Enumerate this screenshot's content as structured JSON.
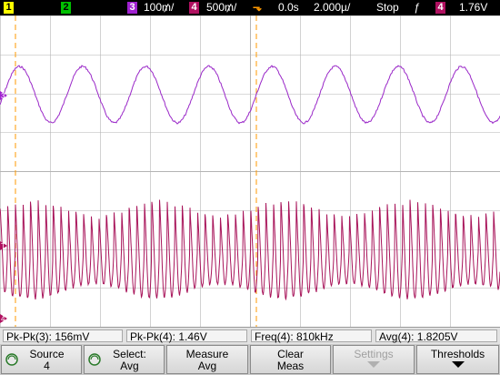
{
  "top_bar": {
    "ch1_label": "1",
    "ch2_label": "2",
    "ch3_label": "3",
    "ch3_scale": "100₥/",
    "ch4_label": "4",
    "ch4_scale": "500₥/",
    "trigger_marker": "⬎",
    "time_delay": "0.0s",
    "time_scale": "2.000µ/",
    "run_state": "Stop",
    "trigger_slope": "ƒ",
    "trigger_source": "4",
    "trigger_level": "1.76V"
  },
  "colors": {
    "ch1": "#ffff00",
    "ch2": "#00c000",
    "ch3": "#a020d0",
    "ch4": "#b01060",
    "grid": "#b4b4b4",
    "cursor": "#ff9900"
  },
  "screen": {
    "ch3_marker": "3",
    "trigger_level_marker": "T",
    "ch4_marker": "4"
  },
  "measurements": [
    {
      "label": "Pk-Pk(3): 156mV"
    },
    {
      "label": "Pk-Pk(4): 1.46V"
    },
    {
      "label": "Freq(4): 810kHz"
    },
    {
      "label": "Avg(4): 1.8205V"
    }
  ],
  "softkeys": [
    {
      "line1": "Source",
      "line2": "4",
      "icon": "knob-icon",
      "enabled": true
    },
    {
      "line1": "Select:",
      "line2": "Avg",
      "icon": "knob-icon",
      "enabled": true
    },
    {
      "line1": "Measure",
      "line2": "Avg",
      "icon": "",
      "enabled": true
    },
    {
      "line1": "Clear",
      "line2": "Meas",
      "icon": "",
      "enabled": true
    },
    {
      "line1": "Settings",
      "line2": "",
      "icon": "arrow-down-icon",
      "enabled": false
    },
    {
      "line1": "Thresholds",
      "line2": "",
      "icon": "arrow-down-icon",
      "enabled": true
    }
  ]
}
